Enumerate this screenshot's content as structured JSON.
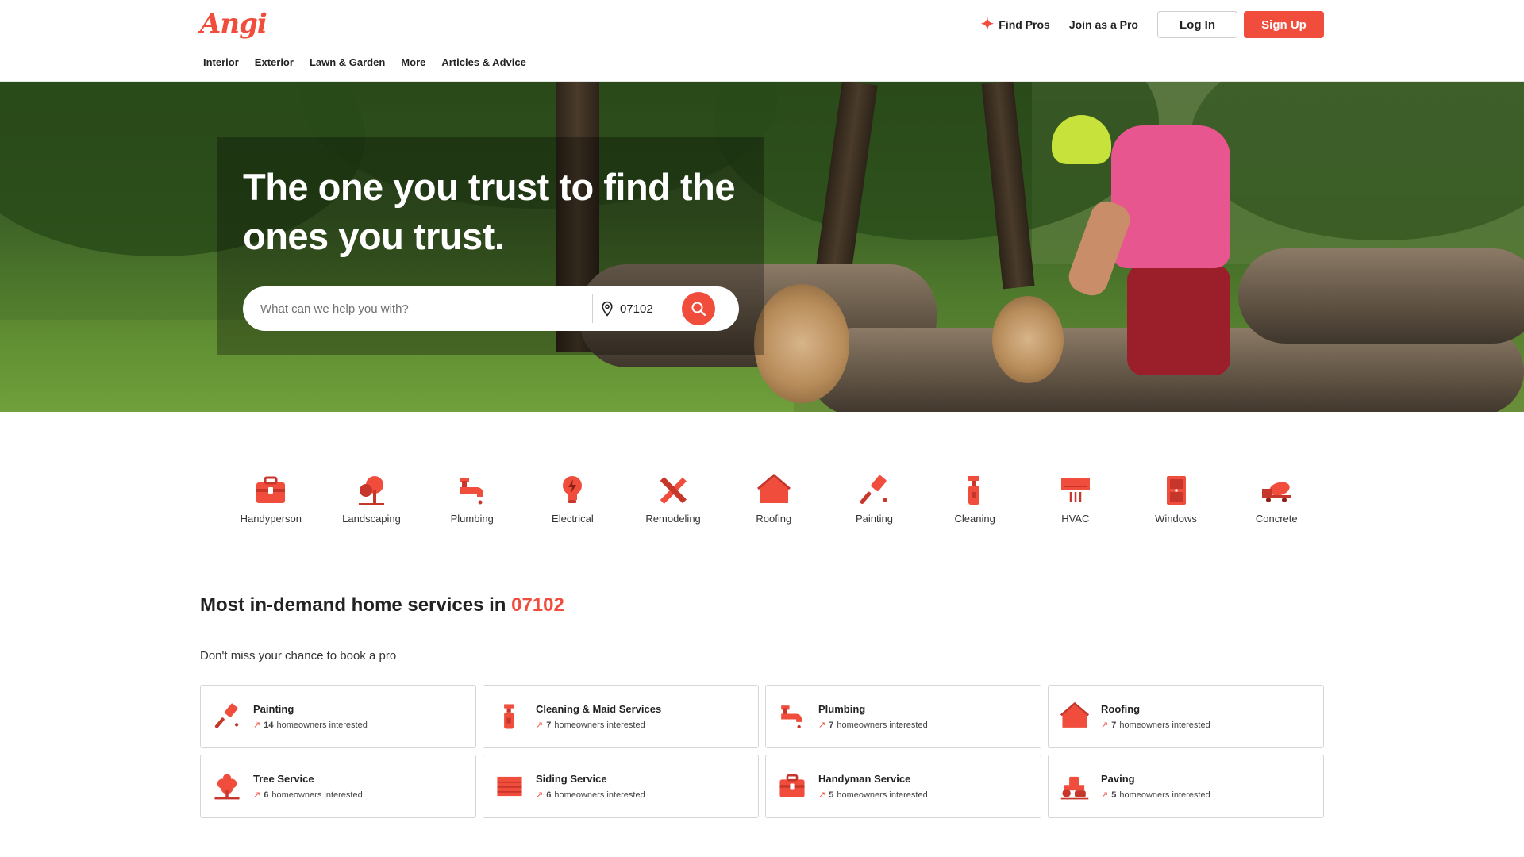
{
  "brand": {
    "logo_text": "Angi",
    "accent": "#f04d3c"
  },
  "header": {
    "find_pros": "Find Pros",
    "join_pro": "Join as a Pro",
    "login": "Log In",
    "signup": "Sign Up"
  },
  "nav": [
    "Interior",
    "Exterior",
    "Lawn & Garden",
    "More",
    "Articles & Advice"
  ],
  "hero": {
    "title": "The one you trust to find the ones you trust.",
    "search_placeholder": "What can we help you with?",
    "zip": "07102"
  },
  "categories": [
    {
      "label": "Handyperson",
      "icon": "toolbox-icon"
    },
    {
      "label": "Landscaping",
      "icon": "tree-icon"
    },
    {
      "label": "Plumbing",
      "icon": "faucet-icon"
    },
    {
      "label": "Electrical",
      "icon": "lightbulb-icon"
    },
    {
      "label": "Remodeling",
      "icon": "ruler-pencil-icon"
    },
    {
      "label": "Roofing",
      "icon": "house-icon"
    },
    {
      "label": "Painting",
      "icon": "paintbrush-icon"
    },
    {
      "label": "Cleaning",
      "icon": "spray-bottle-icon"
    },
    {
      "label": "HVAC",
      "icon": "air-conditioner-icon"
    },
    {
      "label": "Windows",
      "icon": "window-icon"
    },
    {
      "label": "Concrete",
      "icon": "cement-mixer-icon"
    }
  ],
  "demand": {
    "title_prefix": "Most in-demand home services in",
    "zip": "07102",
    "subtitle": "Don't miss your chance to book a pro",
    "suffix": "homeowners interested",
    "services": [
      {
        "name": "Painting",
        "count": "14",
        "icon": "paintbrush-icon"
      },
      {
        "name": "Cleaning & Maid Services",
        "count": "7",
        "icon": "spray-bottle-icon"
      },
      {
        "name": "Plumbing",
        "count": "7",
        "icon": "faucet-icon"
      },
      {
        "name": "Roofing",
        "count": "7",
        "icon": "house-icon"
      },
      {
        "name": "Tree Service",
        "count": "6",
        "icon": "tree-icon"
      },
      {
        "name": "Siding Service",
        "count": "6",
        "icon": "siding-icon"
      },
      {
        "name": "Handyman Service",
        "count": "5",
        "icon": "toolbox-icon"
      },
      {
        "name": "Paving",
        "count": "5",
        "icon": "paving-roller-icon"
      }
    ]
  }
}
